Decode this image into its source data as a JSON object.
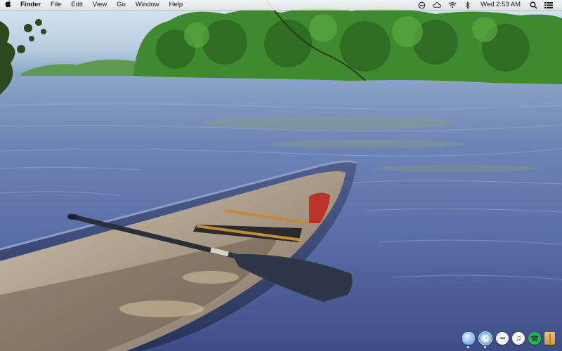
{
  "menubar": {
    "apple_icon": "apple-icon",
    "app_name": "Finder",
    "menus": [
      "File",
      "Edit",
      "View",
      "Go",
      "Window",
      "Help"
    ],
    "status_icons": [
      "sync-icon",
      "cloud-icon",
      "wifi-icon",
      "bluetooth-icon"
    ],
    "clock": "Wed 2:53 AM",
    "spotlight_icon": "search-icon",
    "notifications_icon": "list-icon"
  },
  "dock": {
    "items": [
      {
        "name": "cloud-app-icon",
        "glyph": ""
      },
      {
        "name": "safari-icon",
        "glyph": ""
      },
      {
        "name": "messages-icon",
        "glyph": "•••"
      },
      {
        "name": "music-icon",
        "glyph": "♫"
      },
      {
        "name": "spotify-icon",
        "glyph": ""
      },
      {
        "name": "archive-icon",
        "glyph": ""
      }
    ]
  },
  "colors": {
    "water": "#5a6ea6",
    "trees": "#3f8a2e",
    "canoe_hull": "#3a4a78",
    "canoe_inner": "#b9a890",
    "paddle": "#2b2f3a"
  }
}
